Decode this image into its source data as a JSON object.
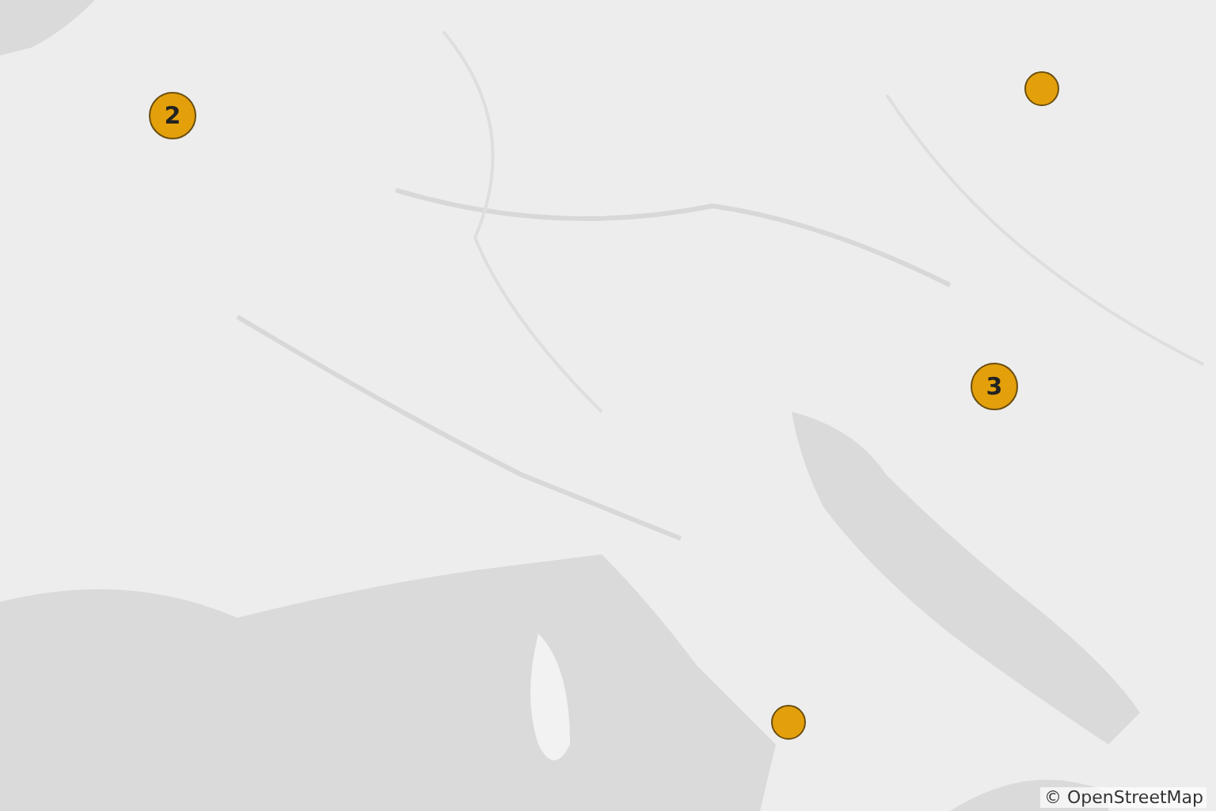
{
  "markers": [
    {
      "kind": "cluster",
      "count": "2"
    },
    {
      "kind": "point"
    },
    {
      "kind": "cluster",
      "count": "3"
    },
    {
      "kind": "point"
    }
  ],
  "attribution": "© OpenStreetMap"
}
